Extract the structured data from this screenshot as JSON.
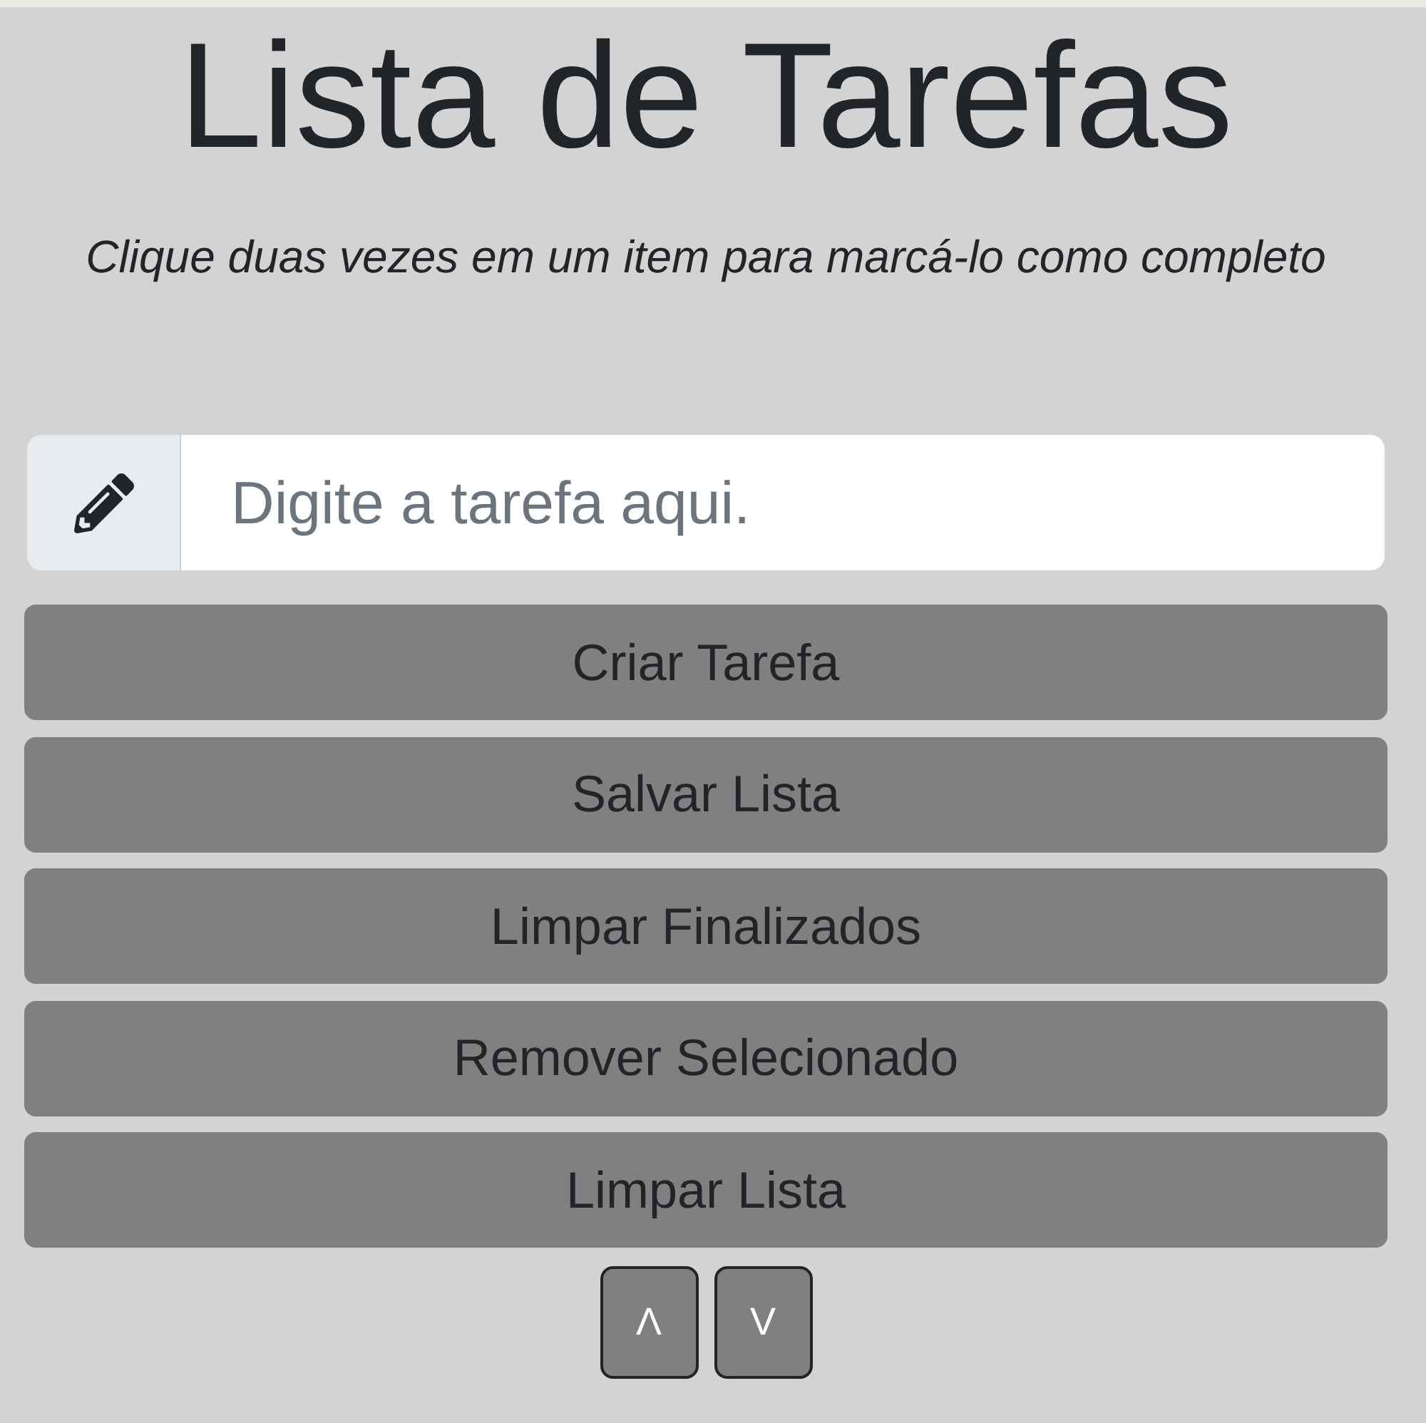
{
  "title": "Lista de Tarefas",
  "subtitle": "Clique duas vezes em um item para marcá-lo como completo",
  "task_input": {
    "placeholder": "Digite a tarefa aqui."
  },
  "buttons": [
    "Criar Tarefa",
    "Salvar Lista",
    "Limpar Finalizados",
    "Remover Selecionado",
    "Limpar Lista"
  ],
  "move_buttons": [
    {
      "label": "Λ"
    },
    {
      "label": "V"
    }
  ]
}
